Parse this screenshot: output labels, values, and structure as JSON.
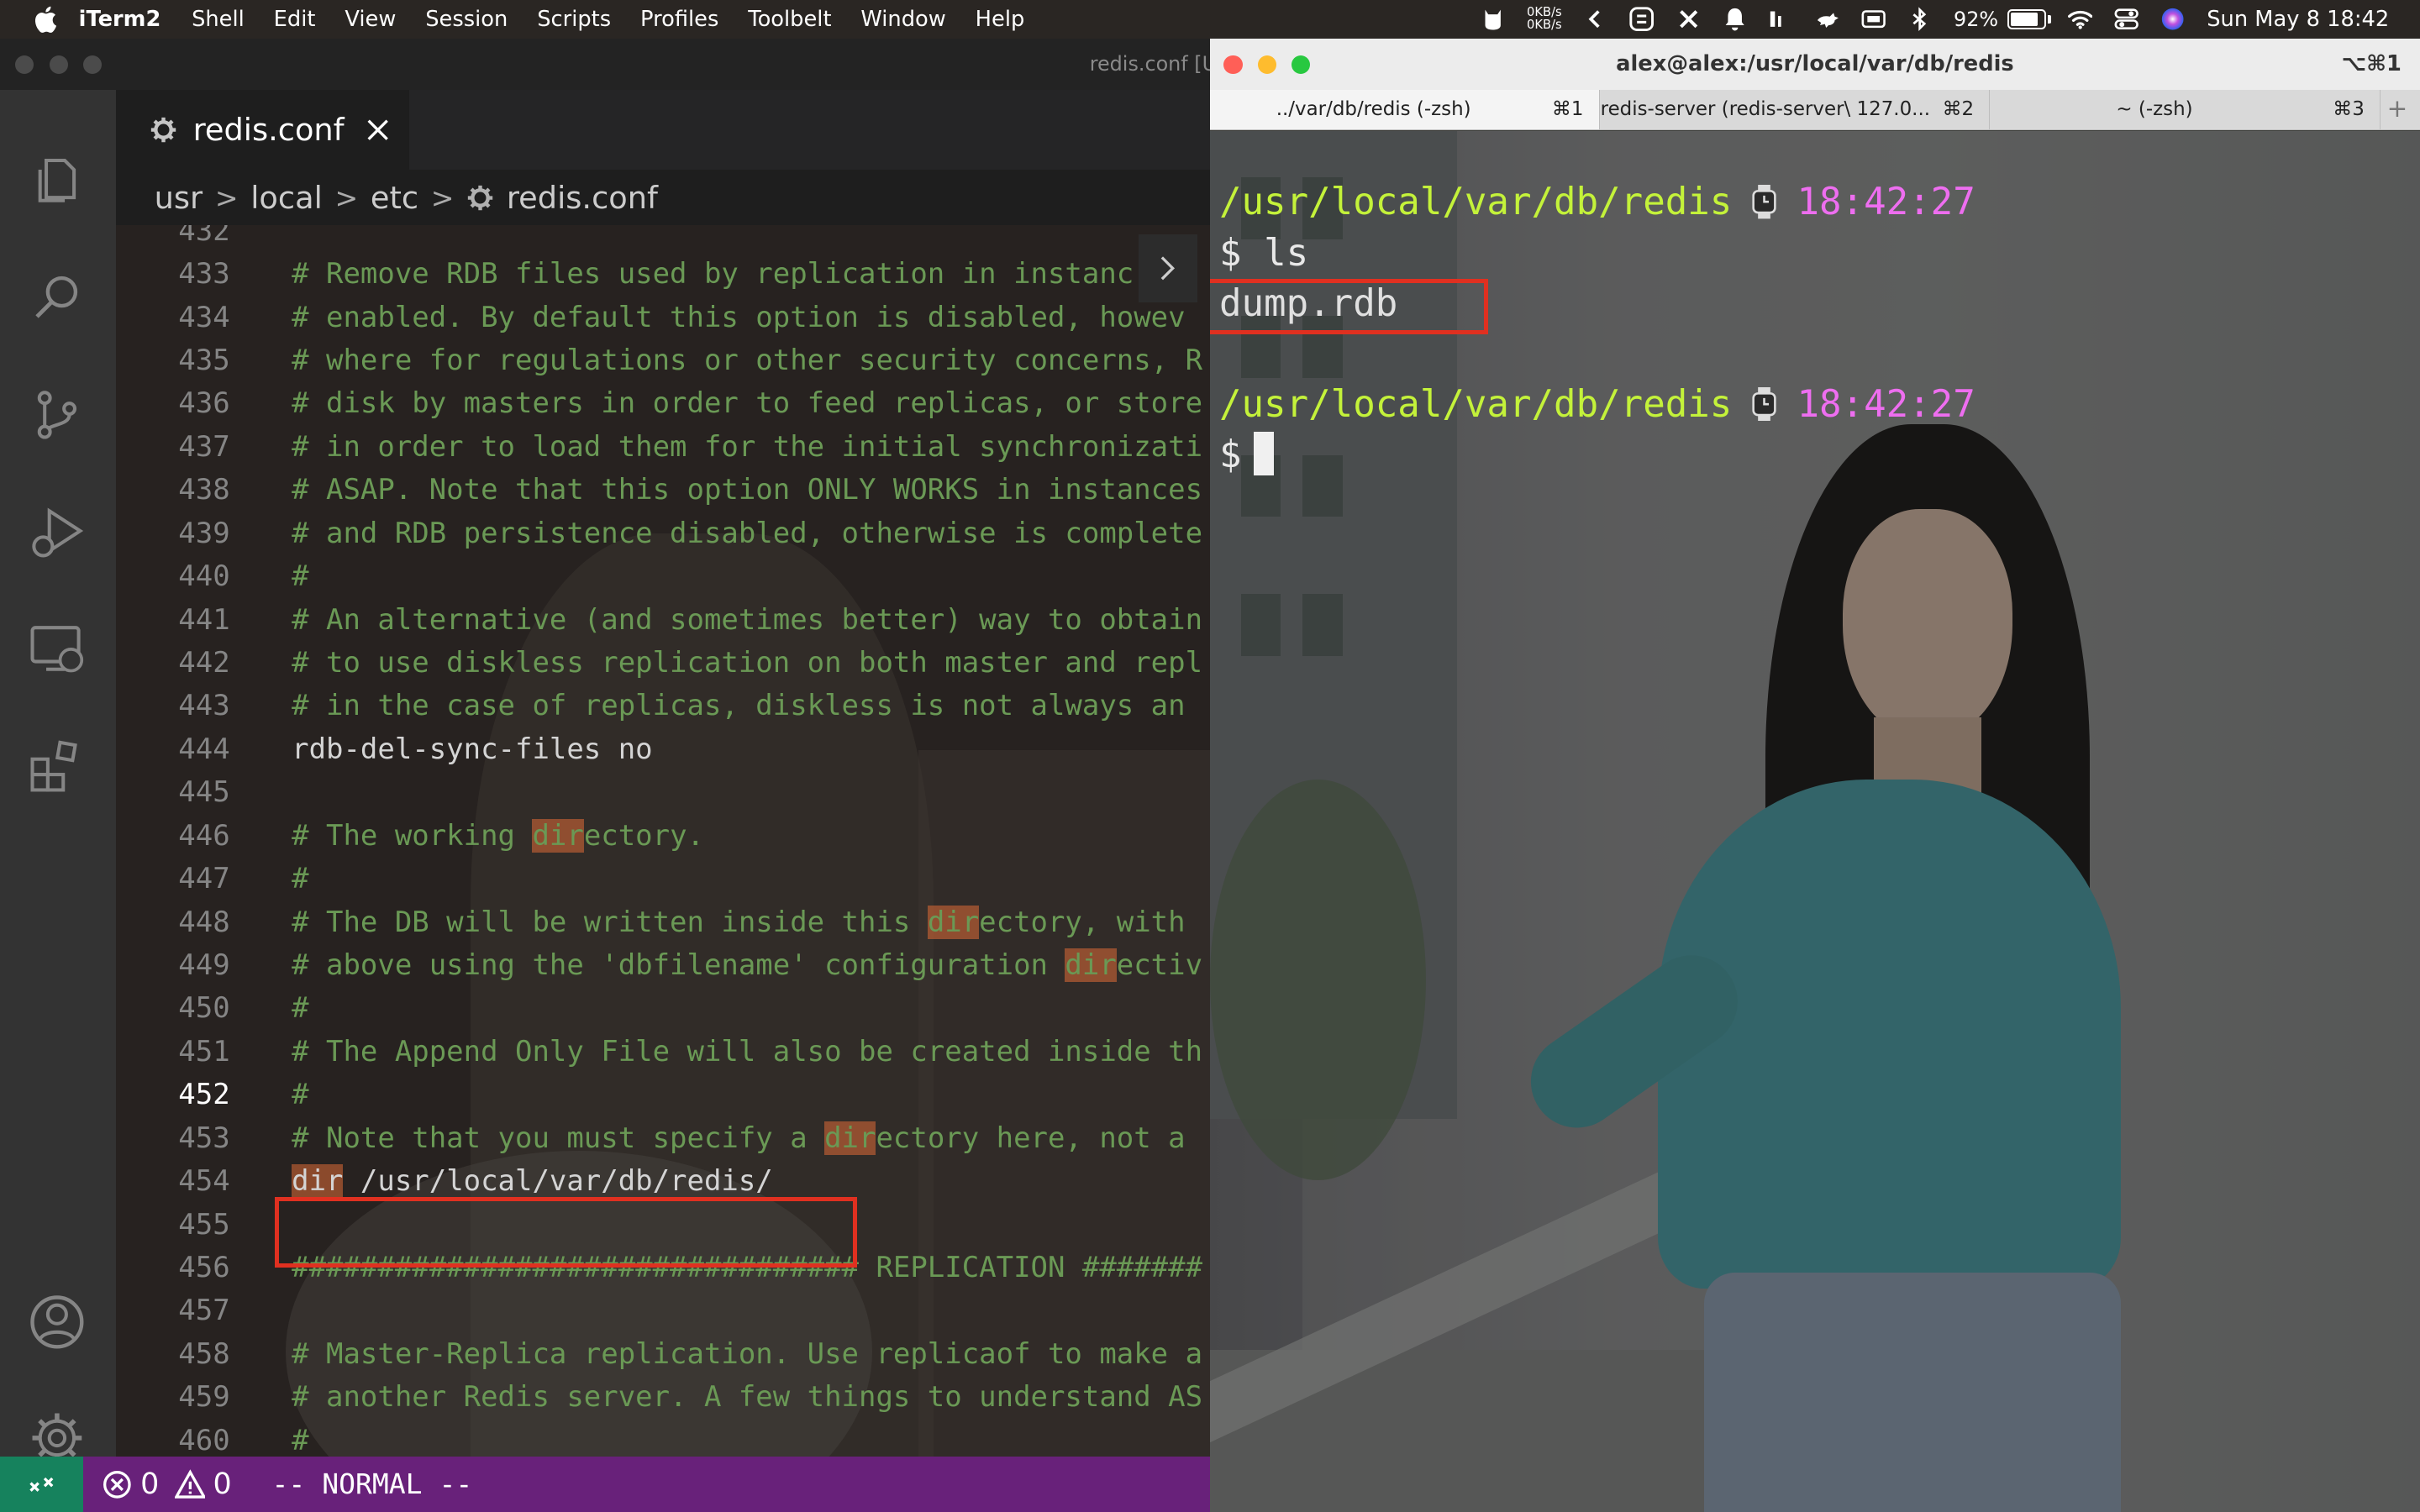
{
  "menubar": {
    "app_name": "iTerm2",
    "menus": [
      "Shell",
      "Edit",
      "View",
      "Session",
      "Scripts",
      "Profiles",
      "Toolbelt",
      "Window",
      "Help"
    ],
    "net_up": "0KB/s",
    "net_down": "0KB/s",
    "battery_percent": "92%",
    "battery_level": 0.92,
    "datetime": "Sun May 8  18:42"
  },
  "editor": {
    "window_title": "redis.conf [U",
    "tab": {
      "label": "redis.conf",
      "icon": "gear-icon"
    },
    "breadcrumb": [
      "usr",
      "local",
      "etc",
      "redis.conf"
    ],
    "activity_icons": [
      "files-icon",
      "search-icon",
      "source-control-icon",
      "run-debug-icon",
      "remote-explorer-icon",
      "extensions-icon",
      "account-icon",
      "settings-gear-icon"
    ],
    "lines": [
      {
        "n": "432",
        "t": ""
      },
      {
        "n": "433",
        "t": "# Remove RDB files used by replication in instanc"
      },
      {
        "n": "434",
        "t": "# enabled. By default this option is disabled, howev"
      },
      {
        "n": "435",
        "t": "# where for regulations or other security concerns, R"
      },
      {
        "n": "436",
        "t": "# disk by masters in order to feed replicas, or store"
      },
      {
        "n": "437",
        "t": "# in order to load them for the initial synchronizati"
      },
      {
        "n": "438",
        "t": "# ASAP. Note that this option ONLY WORKS in instances"
      },
      {
        "n": "439",
        "t": "# and RDB persistence disabled, otherwise is complete"
      },
      {
        "n": "440",
        "t": "#"
      },
      {
        "n": "441",
        "t": "# An alternative (and sometimes better) way to obtain"
      },
      {
        "n": "442",
        "t": "# to use diskless replication on both master and repl"
      },
      {
        "n": "443",
        "t": "# in the case of replicas, diskless is not always an"
      },
      {
        "n": "444",
        "t": "rdb-del-sync-files no"
      },
      {
        "n": "445",
        "t": ""
      },
      {
        "n": "446",
        "t": "# The working directory."
      },
      {
        "n": "447",
        "t": "#"
      },
      {
        "n": "448",
        "t": "# The DB will be written inside this directory, with"
      },
      {
        "n": "449",
        "t": "# above using the 'dbfilename' configuration directiv"
      },
      {
        "n": "450",
        "t": "#"
      },
      {
        "n": "451",
        "t": "# The Append Only File will also be created inside th"
      },
      {
        "n": "452",
        "t": "#"
      },
      {
        "n": "453",
        "t": "# Note that you must specify a directory here, not a"
      },
      {
        "n": "454",
        "t": "dir /usr/local/var/db/redis/"
      },
      {
        "n": "455",
        "t": ""
      },
      {
        "n": "456",
        "t": "################################# REPLICATION #######"
      },
      {
        "n": "457",
        "t": ""
      },
      {
        "n": "458",
        "t": "# Master-Replica replication. Use replicaof to make a"
      },
      {
        "n": "459",
        "t": "# another Redis server. A few things to understand AS"
      },
      {
        "n": "460",
        "t": "#"
      }
    ],
    "search_highlight": "dir",
    "status": {
      "errors": "0",
      "warnings": "0",
      "mode": "-- NORMAL --"
    }
  },
  "terminal": {
    "window_title": "alex@alex:/usr/local/var/db/redis",
    "window_shortcut": "⌥⌘1",
    "tabs": [
      {
        "label": "../var/db/redis (-zsh)",
        "shortcut": "⌘1"
      },
      {
        "label": "redis-server (redis-server\\ 127.0...",
        "shortcut": "⌘2"
      },
      {
        "label": "~ (-zsh)",
        "shortcut": "⌘3"
      }
    ],
    "prompt1": {
      "path": "/usr/local/var/db/redis",
      "time": "18:42:27"
    },
    "dollar": "$",
    "command": "ls",
    "output": "dump.rdb",
    "prompt2": {
      "path": "/usr/local/var/db/redis",
      "time": "18:42:27"
    }
  },
  "colors": {
    "statusbar": "#68217a",
    "remote_indicator": "#16825d",
    "prompt_path": "#c4f23a",
    "prompt_time": "#ee6ef0",
    "annotation_box": "#e03020",
    "comment": "#6a9955"
  }
}
